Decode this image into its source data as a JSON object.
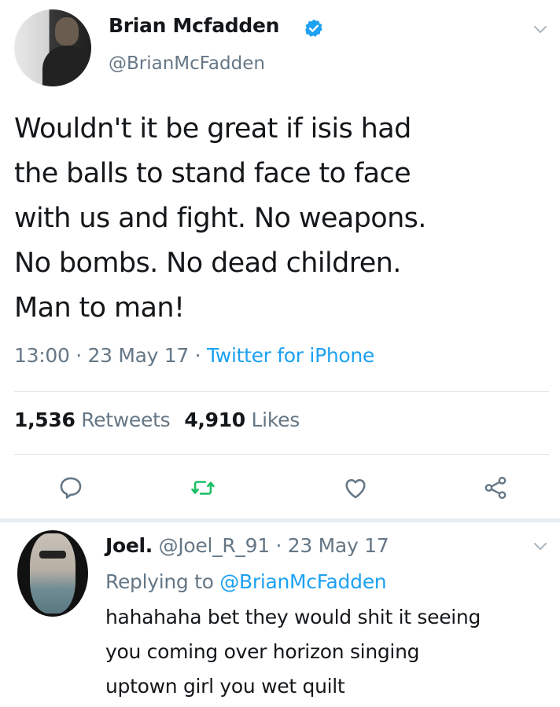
{
  "tweet": {
    "author_name": "Brian Mcfadden",
    "author_handle": "@BrianMcFadden",
    "verified": true,
    "text_lines": [
      "Wouldn't it be great if isis had",
      "the balls to stand face to face",
      "with us and fight. No weapons.",
      "No bombs. No dead children.",
      "Man to man!"
    ],
    "time": "13:00",
    "dot1": " · ",
    "date": "23 May 17",
    "dot2": " · ",
    "source": "Twitter for iPhone",
    "retweets_count": "1,536",
    "retweets_label": "Retweets",
    "likes_count": "4,910",
    "likes_label": "Likes"
  },
  "icons": {
    "reply": "reply-icon",
    "retweet": "retweet-icon",
    "like": "heart-icon",
    "share": "share-icon",
    "verified": "verified-badge-icon",
    "menu": "chevron-down-icon"
  },
  "reply": {
    "author_name": "Joel.",
    "author_handle": "@Joel_R_91",
    "dot": " · ",
    "date": "23 May 17",
    "replying_to_label": "Replying to ",
    "replying_to_handle": "@BrianMcFadden",
    "text_lines": [
      "hahahaha bet they would shit it seeing",
      "you coming over horizon singing",
      "uptown girl you wet quilt"
    ]
  },
  "colors": {
    "text": "#14171a",
    "secondary": "#657786",
    "accent": "#1da1f2",
    "retweet_green": "#17bf63",
    "divider": "#e1e8ed"
  }
}
